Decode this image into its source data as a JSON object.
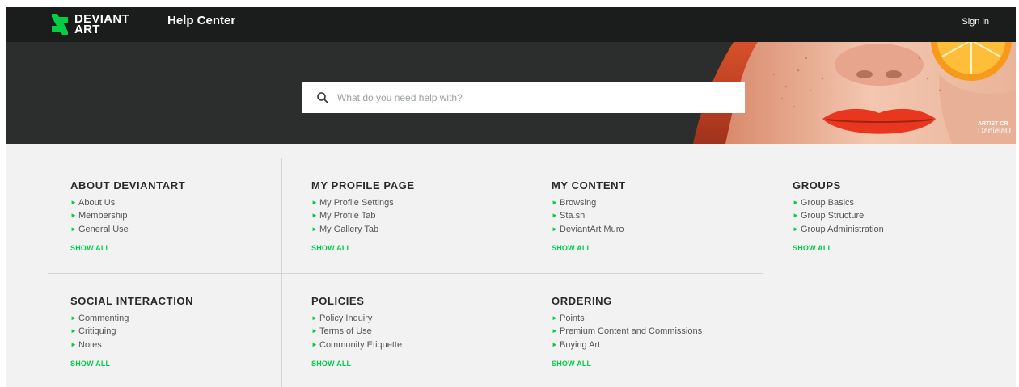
{
  "brand": {
    "logo_line1": "DEVIANT",
    "logo_line2": "ART",
    "accent": "#05cc47"
  },
  "header": {
    "title": "Help Center",
    "signin_label": "Sign in"
  },
  "hero": {
    "search_placeholder": "What do you need help with?",
    "credit_label": "ARTIST CR",
    "credit_name": "DanielaU"
  },
  "categories": [
    {
      "title": "ABOUT DEVIANTART",
      "links": [
        "About Us",
        "Membership",
        "General Use"
      ],
      "show_all": "SHOW ALL"
    },
    {
      "title": "MY PROFILE PAGE",
      "links": [
        "My Profile Settings",
        "My Profile Tab",
        "My Gallery Tab"
      ],
      "show_all": "SHOW ALL"
    },
    {
      "title": "MY CONTENT",
      "links": [
        "Browsing",
        "Sta.sh",
        "DeviantArt Muro"
      ],
      "show_all": "SHOW ALL"
    },
    {
      "title": "GROUPS",
      "links": [
        "Group Basics",
        "Group Structure",
        "Group Administration"
      ],
      "show_all": "SHOW ALL"
    },
    {
      "title": "SOCIAL INTERACTION",
      "links": [
        "Commenting",
        "Critiquing",
        "Notes"
      ],
      "show_all": "SHOW ALL"
    },
    {
      "title": "POLICIES",
      "links": [
        "Policy Inquiry",
        "Terms of Use",
        "Community Etiquette"
      ],
      "show_all": "SHOW ALL"
    },
    {
      "title": "ORDERING",
      "links": [
        "Points",
        "Premium Content and Commissions",
        "Buying Art"
      ],
      "show_all": "SHOW ALL"
    }
  ]
}
